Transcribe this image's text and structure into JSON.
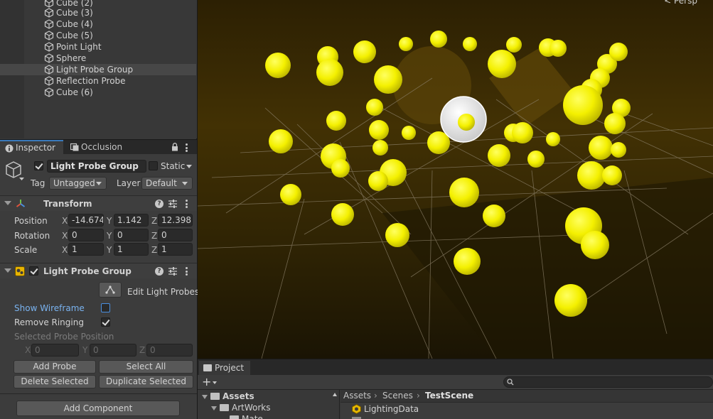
{
  "hierarchy": {
    "items": [
      {
        "label": "Cube (2)"
      },
      {
        "label": "Cube (3)"
      },
      {
        "label": "Cube (4)"
      },
      {
        "label": "Cube (5)"
      },
      {
        "label": "Point Light"
      },
      {
        "label": "Sphere"
      },
      {
        "label": "Light Probe Group",
        "selected": true
      },
      {
        "label": "Reflection Probe"
      },
      {
        "label": "Cube (6)"
      }
    ]
  },
  "inspector_tabs": {
    "inspector": "Inspector",
    "occlusion": "Occlusion"
  },
  "gameobject": {
    "name": "Light Probe Group",
    "active": true,
    "static_label": "Static",
    "static_checked": false,
    "tag_label": "Tag",
    "tag_value": "Untagged",
    "layer_label": "Layer",
    "layer_value": "Default"
  },
  "transform": {
    "title": "Transform",
    "position_label": "Position",
    "rotation_label": "Rotation",
    "scale_label": "Scale",
    "position": {
      "x": "-14.674",
      "y": "1.142",
      "z": "12.398"
    },
    "rotation": {
      "x": "0",
      "y": "0",
      "z": "0"
    },
    "scale": {
      "x": "1",
      "y": "1",
      "z": "1"
    }
  },
  "axes": {
    "x": "X",
    "y": "Y",
    "z": "Z"
  },
  "light_probe_group": {
    "title": "Light Probe Group",
    "enabled": true,
    "edit_label": "Edit Light Probes",
    "show_wireframe_label": "Show Wireframe",
    "show_wireframe": false,
    "remove_ringing_label": "Remove Ringing",
    "remove_ringing": true,
    "selected_probe_position_label": "Selected Probe Position",
    "selected": {
      "x": "0",
      "y": "0",
      "z": "0"
    },
    "add_probe": "Add Probe",
    "select_all": "Select All",
    "delete_selected": "Delete Selected",
    "duplicate_selected": "Duplicate Selected"
  },
  "add_component": "Add Component",
  "scene": {
    "persp_label": "< Persp",
    "probe_color": "#ffff00"
  },
  "project": {
    "tab_label": "Project",
    "add_label": "+",
    "tree": {
      "assets": "Assets",
      "artworks": "ArtWorks",
      "mate": "Mate"
    },
    "breadcrumb": [
      "Assets",
      "Scenes",
      "TestScene"
    ],
    "files": [
      {
        "label": "LightingData"
      }
    ]
  }
}
